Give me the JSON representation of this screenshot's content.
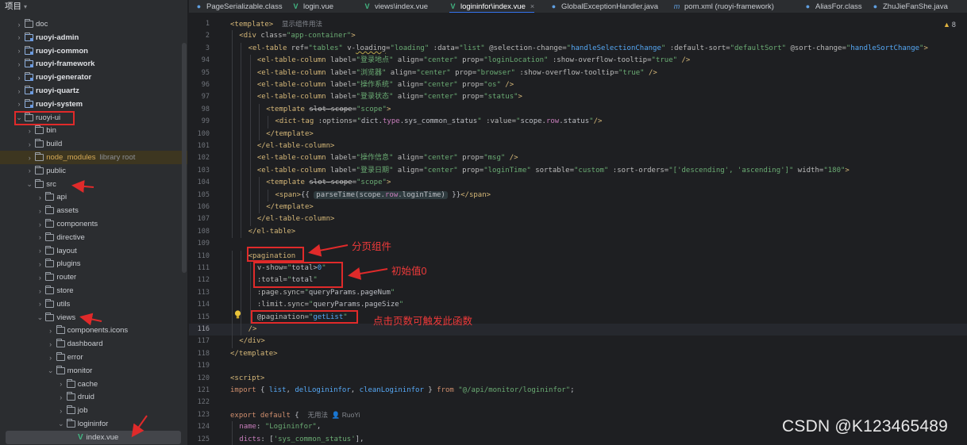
{
  "project": {
    "title": "项目",
    "items": [
      {
        "label": "doc",
        "level": 1,
        "chev": "›",
        "kind": "folder"
      },
      {
        "label": "ruoyi-admin",
        "level": 1,
        "chev": "›",
        "kind": "module",
        "bold": true
      },
      {
        "label": "ruoyi-common",
        "level": 1,
        "chev": "›",
        "kind": "module",
        "bold": true
      },
      {
        "label": "ruoyi-framework",
        "level": 1,
        "chev": "›",
        "kind": "module",
        "bold": true
      },
      {
        "label": "ruoyi-generator",
        "level": 1,
        "chev": "›",
        "kind": "module",
        "bold": true
      },
      {
        "label": "ruoyi-quartz",
        "level": 1,
        "chev": "›",
        "kind": "module",
        "bold": true
      },
      {
        "label": "ruoyi-system",
        "level": 1,
        "chev": "›",
        "kind": "module",
        "bold": true
      },
      {
        "label": "ruoyi-ui",
        "level": 1,
        "chev": "⌄",
        "kind": "folder"
      },
      {
        "label": "bin",
        "level": 2,
        "chev": "›",
        "kind": "folder"
      },
      {
        "label": "build",
        "level": 2,
        "chev": "›",
        "kind": "folder"
      },
      {
        "label": "node_modules",
        "level": 2,
        "chev": "›",
        "kind": "folder",
        "nm": true,
        "sub": "library root"
      },
      {
        "label": "public",
        "level": 2,
        "chev": "›",
        "kind": "folder"
      },
      {
        "label": "src",
        "level": 2,
        "chev": "⌄",
        "kind": "folder"
      },
      {
        "label": "api",
        "level": 3,
        "chev": "›",
        "kind": "folder"
      },
      {
        "label": "assets",
        "level": 3,
        "chev": "›",
        "kind": "folder"
      },
      {
        "label": "components",
        "level": 3,
        "chev": "›",
        "kind": "folder"
      },
      {
        "label": "directive",
        "level": 3,
        "chev": "›",
        "kind": "folder"
      },
      {
        "label": "layout",
        "level": 3,
        "chev": "›",
        "kind": "folder"
      },
      {
        "label": "plugins",
        "level": 3,
        "chev": "›",
        "kind": "folder"
      },
      {
        "label": "router",
        "level": 3,
        "chev": "›",
        "kind": "folder"
      },
      {
        "label": "store",
        "level": 3,
        "chev": "›",
        "kind": "folder"
      },
      {
        "label": "utils",
        "level": 3,
        "chev": "›",
        "kind": "folder"
      },
      {
        "label": "views",
        "level": 3,
        "chev": "⌄",
        "kind": "folder"
      },
      {
        "label": "components.icons",
        "level": 4,
        "chev": "›",
        "kind": "folder"
      },
      {
        "label": "dashboard",
        "level": 4,
        "chev": "›",
        "kind": "folder"
      },
      {
        "label": "error",
        "level": 4,
        "chev": "›",
        "kind": "folder"
      },
      {
        "label": "monitor",
        "level": 4,
        "chev": "⌄",
        "kind": "folder"
      },
      {
        "label": "cache",
        "level": 5,
        "chev": "›",
        "kind": "folder"
      },
      {
        "label": "druid",
        "level": 5,
        "chev": "›",
        "kind": "folder"
      },
      {
        "label": "job",
        "level": 5,
        "chev": "›",
        "kind": "folder"
      },
      {
        "label": "logininfor",
        "level": 5,
        "chev": "⌄",
        "kind": "folder"
      },
      {
        "label": "index.vue",
        "level": 6,
        "chev": "",
        "kind": "vue",
        "selected": true
      }
    ]
  },
  "tabs": [
    {
      "label": "PageSerializable.class",
      "icon": "c"
    },
    {
      "label": "login.vue",
      "icon": "v"
    },
    {
      "label": "views\\index.vue",
      "icon": "v"
    },
    {
      "label": "logininfor\\index.vue",
      "icon": "v",
      "active": true
    },
    {
      "label": "GlobalExceptionHandler.java",
      "icon": "c"
    },
    {
      "label": "pom.xml (ruoyi-framework)",
      "icon": "m"
    },
    {
      "label": "AliasFor.class",
      "icon": "c"
    },
    {
      "label": "ZhuJieFanShe.java",
      "icon": "c"
    }
  ],
  "editor": {
    "warnings": "8",
    "current_line": "116",
    "lines": [
      {
        "n": "1",
        "indent": 0,
        "html": "<span class=\"t\">&lt;template&gt;</span>  <span class=\"hint\">显示组件用法</span>"
      },
      {
        "n": "2",
        "indent": 1,
        "html": "<span class=\"t\">&lt;div</span> <span class=\"a\">class=</span><span class=\"s\">\"app-container\"</span><span class=\"t\">&gt;</span>"
      },
      {
        "n": "3",
        "indent": 2,
        "html": "<span class=\"t\">&lt;el-table</span> <span class=\"a\">ref=</span><span class=\"s\">\"tables\"</span> <span class=\"a\">v-</span><span class=\"a wavy\">loading</span><span class=\"a\">=</span><span class=\"s\">\"loading\"</span> <span class=\"a\">:data=</span><span class=\"s\">\"list\"</span> <span class=\"a\">@selection-change=</span><span class=\"s\">\"</span><span class=\"f\">handleSelectionChange</span><span class=\"s\">\"</span> <span class=\"a\">:default-sort=</span><span class=\"s\">\"defaultSort\"</span> <span class=\"a\">@sort-change=</span><span class=\"s\">\"</span><span class=\"f\">handleSortChange</span><span class=\"s\">\"</span><span class=\"t\">&gt;</span>"
      },
      {
        "n": "94",
        "indent": 3,
        "html": "<span class=\"t\">&lt;el-table-column</span> <span class=\"a\">label=</span><span class=\"s\">\"登录地点\"</span> <span class=\"a\">align=</span><span class=\"s\">\"center\"</span> <span class=\"a\">prop=</span><span class=\"s\">\"loginLocation\"</span> <span class=\"a\">:show-overflow-tooltip=</span><span class=\"s\">\"true\"</span> <span class=\"t\">/&gt;</span>"
      },
      {
        "n": "95",
        "indent": 3,
        "html": "<span class=\"t\">&lt;el-table-column</span> <span class=\"a\">label=</span><span class=\"s\">\"浏览器\"</span> <span class=\"a\">align=</span><span class=\"s\">\"center\"</span> <span class=\"a\">prop=</span><span class=\"s\">\"browser\"</span> <span class=\"a\">:show-overflow-tooltip=</span><span class=\"s\">\"true\"</span> <span class=\"t\">/&gt;</span>"
      },
      {
        "n": "96",
        "indent": 3,
        "html": "<span class=\"t\">&lt;el-table-column</span> <span class=\"a\">label=</span><span class=\"s\">\"操作系统\"</span> <span class=\"a\">align=</span><span class=\"s\">\"center\"</span> <span class=\"a\">prop=</span><span class=\"s\">\"os\"</span> <span class=\"t\">/&gt;</span>"
      },
      {
        "n": "97",
        "indent": 3,
        "html": "<span class=\"t\">&lt;el-table-column</span> <span class=\"a\">label=</span><span class=\"s\">\"登录状态\"</span> <span class=\"a\">align=</span><span class=\"s\">\"center\"</span> <span class=\"a\">prop=</span><span class=\"s\">\"status\"</span><span class=\"t\">&gt;</span>"
      },
      {
        "n": "98",
        "indent": 4,
        "html": "<span class=\"t\">&lt;template</span> <span class=\"a strike\">slot-scope</span><span class=\"a\">=</span><span class=\"s\">\"scope\"</span><span class=\"t\">&gt;</span>"
      },
      {
        "n": "99",
        "indent": 5,
        "html": "<span class=\"t\">&lt;dict-tag</span> <span class=\"a\">:options=</span><span class=\"s\">\"</span><span class=\"p\">dict.</span><span class=\"v\">type</span><span class=\"p\">.sys_common_status</span><span class=\"s\">\"</span> <span class=\"a\">:value=</span><span class=\"s\">\"</span><span class=\"p\">scope.</span><span class=\"v\">row</span><span class=\"p\">.status</span><span class=\"s\">\"</span><span class=\"t\">/&gt;</span>"
      },
      {
        "n": "100",
        "indent": 4,
        "html": "<span class=\"t\">&lt;/template&gt;</span>"
      },
      {
        "n": "101",
        "indent": 3,
        "html": "<span class=\"t\">&lt;/el-table-column&gt;</span>"
      },
      {
        "n": "102",
        "indent": 3,
        "html": "<span class=\"t\">&lt;el-table-column</span> <span class=\"a\">label=</span><span class=\"s\">\"操作信息\"</span> <span class=\"a\">align=</span><span class=\"s\">\"center\"</span> <span class=\"a\">prop=</span><span class=\"s\">\"msg\"</span> <span class=\"t\">/&gt;</span>"
      },
      {
        "n": "103",
        "indent": 3,
        "html": "<span class=\"t\">&lt;el-table-column</span> <span class=\"a\">label=</span><span class=\"s\">\"登录日期\"</span> <span class=\"a\">align=</span><span class=\"s\">\"center\"</span> <span class=\"a\">prop=</span><span class=\"s\">\"loginTime\"</span> <span class=\"a\">sortable=</span><span class=\"s\">\"custom\"</span> <span class=\"a\">:sort-orders=</span><span class=\"s\">\"['descending', 'ascending']\"</span> <span class=\"a\">width=</span><span class=\"s\">\"180\"</span><span class=\"t\">&gt;</span>"
      },
      {
        "n": "104",
        "indent": 4,
        "html": "<span class=\"t\">&lt;template</span> <span class=\"a strike\">slot-scope</span><span class=\"a\">=</span><span class=\"s\">\"scope\"</span><span class=\"t\">&gt;</span>"
      },
      {
        "n": "105",
        "indent": 5,
        "html": "<span class=\"t\">&lt;span&gt;</span><span class=\"p\">{{ </span><span class=\"pill\"><span class=\"p\">parseTime(scope.</span><span class=\"v\">row</span><span class=\"p\">.loginTime)</span></span><span class=\"p\"> }}</span><span class=\"t\">&lt;/span&gt;</span>"
      },
      {
        "n": "106",
        "indent": 4,
        "html": "<span class=\"t\">&lt;/template&gt;</span>"
      },
      {
        "n": "107",
        "indent": 3,
        "html": "<span class=\"t\">&lt;/el-table-column&gt;</span>"
      },
      {
        "n": "108",
        "indent": 2,
        "html": "<span class=\"t\">&lt;/el-table&gt;</span>"
      },
      {
        "n": "109",
        "indent": 0,
        "html": ""
      },
      {
        "n": "110",
        "indent": 2,
        "html": "<span class=\"t\">&lt;pagination</span>"
      },
      {
        "n": "111",
        "indent": 3,
        "html": "<span class=\"a\">v-show=</span><span class=\"s\">\"</span><span class=\"p\">total&gt;</span><span class=\"f\">0</span><span class=\"s\">\"</span>"
      },
      {
        "n": "112",
        "indent": 3,
        "html": "<span class=\"a\">:total=</span><span class=\"s\">\"</span><span class=\"p\">total</span><span class=\"s\">\"</span>"
      },
      {
        "n": "113",
        "indent": 3,
        "html": "<span class=\"a\">:page.sync=</span><span class=\"s\">\"</span><span class=\"p\">queryParams.pageNum</span><span class=\"s\">\"</span>"
      },
      {
        "n": "114",
        "indent": 3,
        "html": "<span class=\"a\">:limit.sync=</span><span class=\"s\">\"</span><span class=\"p\">queryParams.pageSize</span><span class=\"s\">\"</span>"
      },
      {
        "n": "115",
        "indent": 3,
        "html": "<span class=\"a\">@pagination=</span><span class=\"s\">\"</span><span class=\"f\">getList</span><span class=\"s\">\"</span>"
      },
      {
        "n": "116",
        "indent": 2,
        "html": "<span class=\"t\">/&gt;</span>"
      },
      {
        "n": "117",
        "indent": 1,
        "html": "<span class=\"t\">&lt;/div&gt;</span>"
      },
      {
        "n": "118",
        "indent": 0,
        "html": "<span class=\"t\">&lt;/template&gt;</span>"
      },
      {
        "n": "119",
        "indent": 0,
        "html": ""
      },
      {
        "n": "120",
        "indent": 0,
        "html": "<span class=\"t\">&lt;script&gt;</span>"
      },
      {
        "n": "121",
        "indent": 0,
        "html": "<span class=\"k\">import</span> <span class=\"p\">{ </span><span class=\"f\">list</span><span class=\"p\">, </span><span class=\"f\">delLogininfor</span><span class=\"p\">, </span><span class=\"f\">cleanLogininfor</span><span class=\"p\"> } </span><span class=\"k\">from</span> <span class=\"s\">\"@/api/monitor/logininfor\"</span><span class=\"p\">;</span>"
      },
      {
        "n": "122",
        "indent": 0,
        "html": ""
      },
      {
        "n": "123",
        "indent": 0,
        "html": "<span class=\"k\">export default</span><span class=\"p\"> {  </span><span class=\"hint\">无用法  👤 RuoYi</span>"
      },
      {
        "n": "124",
        "indent": 1,
        "html": "<span class=\"v\">name</span><span class=\"p\">: </span><span class=\"s\">\"Logininfor\"</span><span class=\"p\">,</span>"
      },
      {
        "n": "125",
        "indent": 1,
        "html": "<span class=\"v\">dicts</span><span class=\"p\">: [</span><span class=\"s\">'sys_common_status'</span><span class=\"p\">],</span>"
      }
    ]
  },
  "annotations": {
    "pagination_label": "分页组件",
    "initial_value_label": "初始值0",
    "pagination_event_label": "点击页数可触发此函数"
  },
  "watermark": "CSDN @K123465489"
}
